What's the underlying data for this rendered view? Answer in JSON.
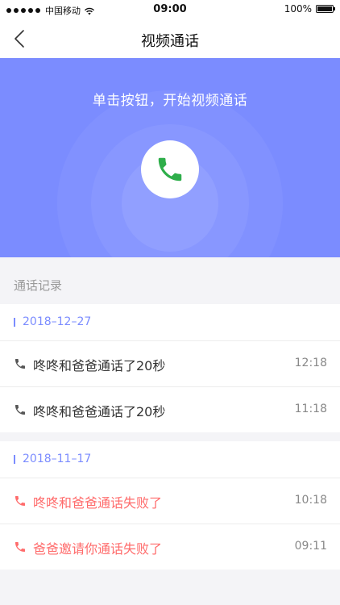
{
  "status_bar": {
    "carrier": "中国移动",
    "time": "09:00",
    "battery": "100%"
  },
  "nav": {
    "title": "视频通话",
    "back_icon": "chevron-left-icon"
  },
  "hero": {
    "prompt": "单击按钮，开始视频通话",
    "call_icon": "phone-icon"
  },
  "colors": {
    "accent": "#7b8cff",
    "success": "#2eae4a",
    "fail": "#ff6b6b"
  },
  "history": {
    "title": "通话记录",
    "groups": [
      {
        "date": "2018–12–27",
        "records": [
          {
            "text": "咚咚和爸爸通话了20秒",
            "time": "12:18",
            "status": "ok"
          },
          {
            "text": "咚咚和爸爸通话了20秒",
            "time": "11:18",
            "status": "ok"
          }
        ]
      },
      {
        "date": "2018–11–17",
        "records": [
          {
            "text": "咚咚和爸爸通话失败了",
            "time": "10:18",
            "status": "fail"
          },
          {
            "text": "爸爸邀请你通话失败了",
            "time": "09:11",
            "status": "fail"
          }
        ]
      }
    ]
  }
}
